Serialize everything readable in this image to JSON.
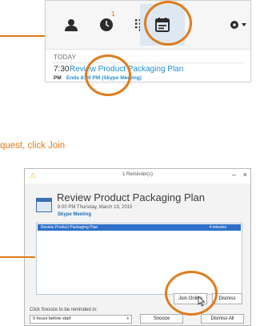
{
  "skype": {
    "missed_count": "1",
    "section_label": "TODAY",
    "meeting": {
      "time": "7:30",
      "ampm": "PM",
      "title": "Review Product Packaging Plan",
      "subtitle": "Ends 8:00 PM (Skype Meeting)"
    },
    "icons": [
      "contacts-icon",
      "recent-icon",
      "dialpad-icon",
      "meetings-icon",
      "settings-icon"
    ],
    "accent": "#1f8fd0"
  },
  "caption": "quest, click Join",
  "reminder": {
    "window_title": "1 Reminder(s)",
    "title": "Review Product Packaging Plan",
    "datetime": "8:00 PM Thursday, March 19, 2015",
    "location": "Skype Meeting",
    "rows": [
      {
        "subject": "Review Product Packaging Plan",
        "due": "4 minutes"
      }
    ],
    "buttons": {
      "join": "Join Online",
      "dismiss": "Dismiss",
      "snooze": "Snooze",
      "dismiss_all": "Dismiss All"
    },
    "snooze_label": "Click Snooze to be reminded in:",
    "snooze_value": "0 hours before start"
  },
  "highlight_color": "#e07b1b"
}
